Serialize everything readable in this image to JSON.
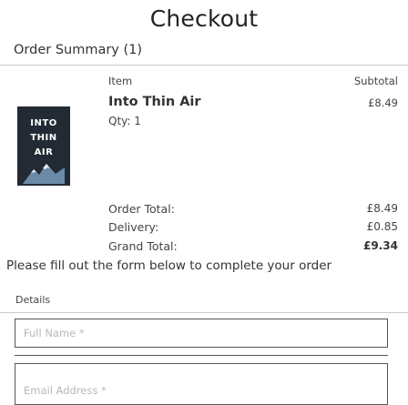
{
  "page": {
    "title": "Checkout"
  },
  "summary": {
    "heading": "Order Summary (1)",
    "columns": {
      "item": "Item",
      "subtotal": "Subtotal"
    },
    "items": [
      {
        "name": "Into Thin Air",
        "quantity": "Qty: 1",
        "subtotal": "£8.49",
        "cover_lines": [
          "INTO",
          "THIN",
          "AIR"
        ]
      }
    ],
    "totals": {
      "order_total_label": "Order Total:",
      "order_total_value": "£8.49",
      "delivery_label": "Delivery:",
      "delivery_value": "£0.85",
      "grand_total_label": "Grand Total:",
      "grand_total_value": "£9.34"
    }
  },
  "form": {
    "instruction": "Please fill out the form below to complete your order",
    "section_label": "Details",
    "full_name": {
      "placeholder": "Full Name *",
      "value": ""
    },
    "email": {
      "placeholder": "Email Address *",
      "value": ""
    }
  }
}
